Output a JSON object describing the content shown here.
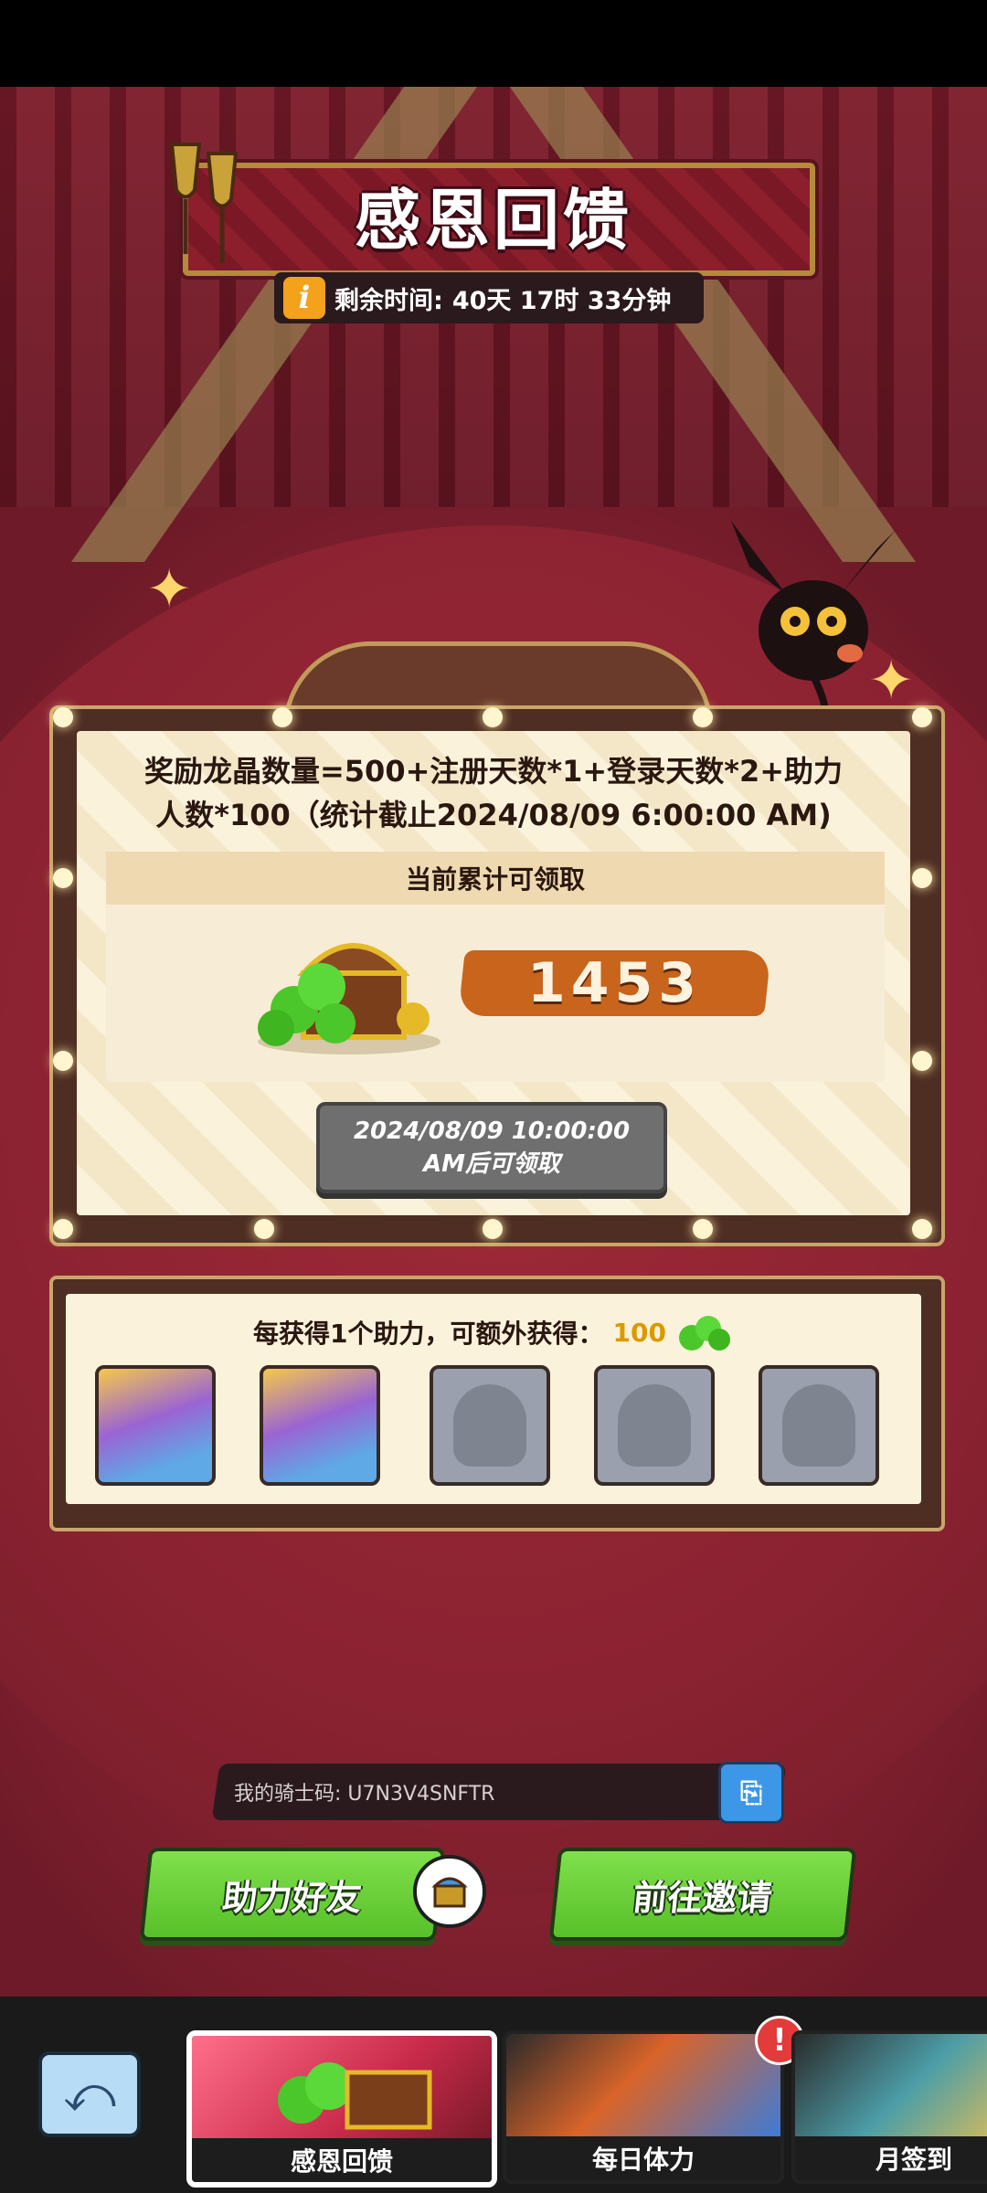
{
  "header": {
    "title": "感恩回馈",
    "timer_label": "剩余时间:",
    "timer_value": "40天 17时 33分钟"
  },
  "reward": {
    "formula_line1": "奖励龙晶数量=500+注册天数*1+登录天数*2+助力",
    "formula_line2": "人数*100（统计截止2024/08/09 6:00:00 AM)",
    "accumulated_label": "当前累计可领取",
    "amount": "1453",
    "claim_button_label": "2024/08/09 10:00:00 AM后可领取"
  },
  "helpers": {
    "title": "每获得1个助力，可额外获得：",
    "bonus": "100",
    "slots": [
      {
        "state": "filled"
      },
      {
        "state": "filled"
      },
      {
        "state": "empty"
      },
      {
        "state": "empty"
      },
      {
        "state": "empty"
      }
    ]
  },
  "knight_code": {
    "label": "我的骑士码: U7N3V4SNFTR"
  },
  "actions": {
    "help_friend": "助力好友",
    "go_invite": "前往邀请"
  },
  "bottom_nav": {
    "tabs": [
      {
        "label": "感恩回馈",
        "active": true
      },
      {
        "label": "每日体力",
        "active": false,
        "alert": "!"
      },
      {
        "label": "月签到",
        "active": false
      }
    ]
  },
  "colors": {
    "accent_orange": "#c8641c",
    "button_green": "#58c02a",
    "info_orange": "#f4a21b",
    "copy_blue": "#3c97e6"
  }
}
